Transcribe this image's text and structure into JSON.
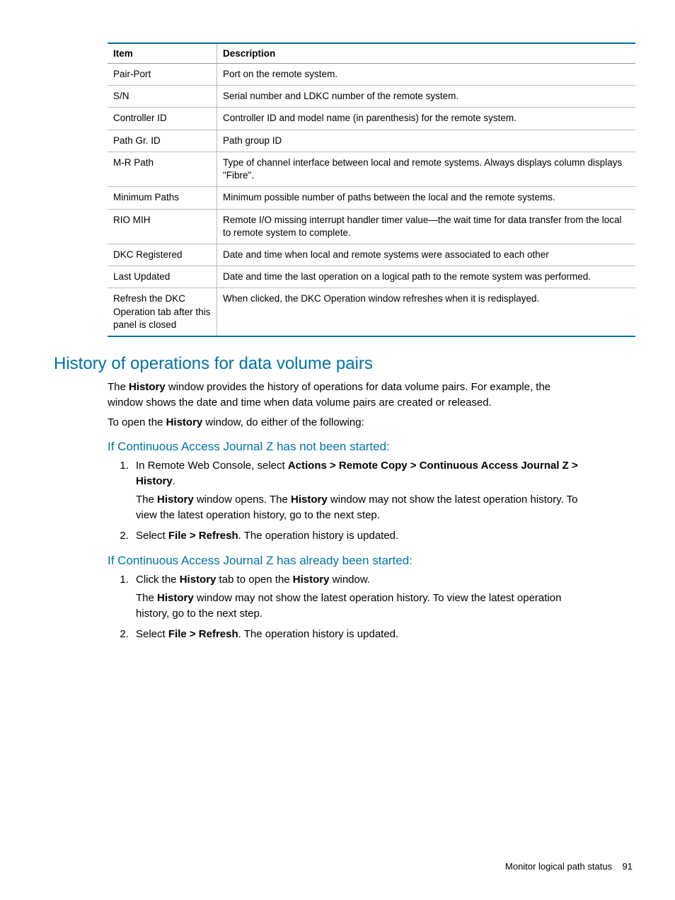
{
  "table": {
    "headers": [
      "Item",
      "Description"
    ],
    "rows": [
      {
        "item": "Pair-Port",
        "desc": "Port on the remote system."
      },
      {
        "item": "S/N",
        "desc": "Serial number and LDKC number of the remote system."
      },
      {
        "item": "Controller ID",
        "desc": "Controller ID and model name (in parenthesis) for the remote system."
      },
      {
        "item": "Path Gr. ID",
        "desc": "Path group ID"
      },
      {
        "item": "M-R Path",
        "desc": "Type of channel interface between local and remote systems. Always displays column displays \"Fibre\"."
      },
      {
        "item": "Minimum Paths",
        "desc": "Minimum possible number of paths between the local and the remote systems."
      },
      {
        "item": "RIO MIH",
        "desc": "Remote I/O missing interrupt handler timer value—the wait time for data transfer from the local to remote system to complete."
      },
      {
        "item": "DKC Registered",
        "desc": "Date and time when local and remote systems were associated to each other"
      },
      {
        "item": "Last Updated",
        "desc": "Date and time the last operation on a logical path to the remote system was performed."
      },
      {
        "item": "Refresh the DKC Operation tab after this panel is closed",
        "desc": "When clicked, the DKC Operation window refreshes when it is redisplayed."
      }
    ]
  },
  "section_heading": "History of operations for data volume pairs",
  "para1_pre": "The ",
  "para1_b1": "History",
  "para1_post": " window provides the history of operations for data volume pairs. For example, the window shows the date and time when data volume pairs are created or released.",
  "para2_pre": "To open the ",
  "para2_b1": "History",
  "para2_post": " window, do either of the following:",
  "sub1": "If Continuous Access Journal Z has not been started:",
  "s1_1_a": "In Remote Web Console, select ",
  "s1_1_b": "Actions > Remote Copy > Continuous Access Journal Z > History",
  "s1_1_c": ".",
  "s1_1p_a": "The ",
  "s1_1p_b": "History",
  "s1_1p_c": " window opens. The ",
  "s1_1p_d": "History",
  "s1_1p_e": " window may not show the latest operation history. To view the latest operation history, go to the next step.",
  "s1_2_a": "Select ",
  "s1_2_b": "File > Refresh",
  "s1_2_c": ". The operation history is updated.",
  "sub2": "If Continuous Access Journal Z has already been started:",
  "s2_1_a": "Click the ",
  "s2_1_b": "History",
  "s2_1_c": " tab to open the ",
  "s2_1_d": "History",
  "s2_1_e": " window.",
  "s2_1p_a": "The ",
  "s2_1p_b": "History",
  "s2_1p_c": " window may not show the latest operation history. To view the latest operation history, go to the next step.",
  "s2_2_a": "Select ",
  "s2_2_b": "File > Refresh",
  "s2_2_c": ". The operation history is updated.",
  "footer_text": "Monitor logical path status",
  "footer_page": "91"
}
